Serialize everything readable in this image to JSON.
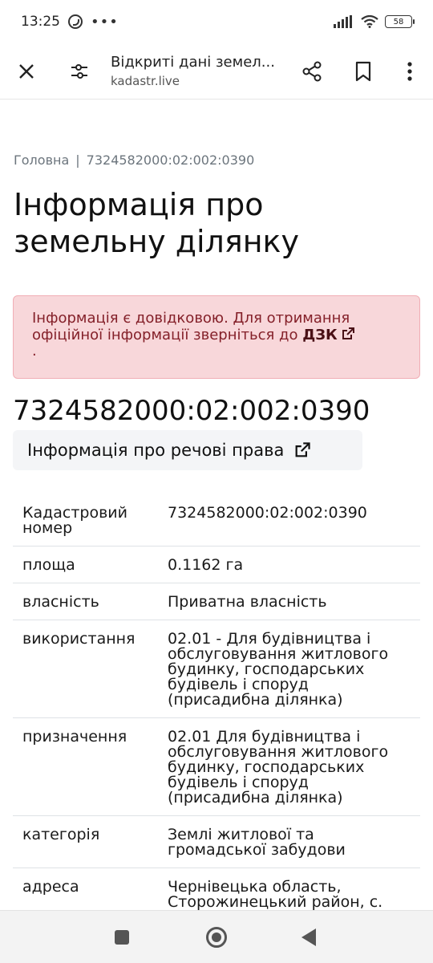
{
  "status_bar": {
    "time": "13:25",
    "battery": "58",
    "icons": [
      "viber-icon",
      "more-dots-icon",
      "signal-icon",
      "wifi-icon",
      "battery-icon"
    ]
  },
  "browser": {
    "title": "Відкриті дані земел...",
    "domain": "kadastr.live",
    "icons": [
      "close-icon",
      "tune-icon",
      "share-icon",
      "bookmark-icon",
      "more-vert-icon"
    ]
  },
  "breadcrumb": {
    "home": "Головна",
    "separator": "|",
    "current": "7324582000:02:002:0390"
  },
  "page_title": "Інформація про земельну ділянку",
  "alert": {
    "text": "Інформація є довідковою. Для отримання офіційної інформації зверніться до",
    "link": "ДЗК",
    "end": "."
  },
  "cadastral_number": "7324582000:02:002:0390",
  "rights_button": "Інформація про речові права",
  "table": [
    {
      "key": "Кадастровий номер",
      "value": "7324582000:02:002:0390"
    },
    {
      "key": "площа",
      "value": "0.1162 га"
    },
    {
      "key": "власність",
      "value": "Приватна власність"
    },
    {
      "key": "використання",
      "value": "02.01 - Для будівництва і обслуговування житлового будинку, господарських будівель і споруд (присадибна ділянка)"
    },
    {
      "key": "призначення",
      "value": "02.01 Для будівництва і обслуговування житлового будинку, господарських будівель і споруд (присадибна ділянка)"
    },
    {
      "key": "категорія",
      "value": "Землі житлової та громадської забудови"
    },
    {
      "key": "адреса",
      "value": "Чернівецька область, Сторожинецький район, с. Великий Кучурів"
    }
  ],
  "colors": {
    "alert_bg": "#f8d7da",
    "alert_text": "#842029",
    "muted": "#6c757d"
  }
}
